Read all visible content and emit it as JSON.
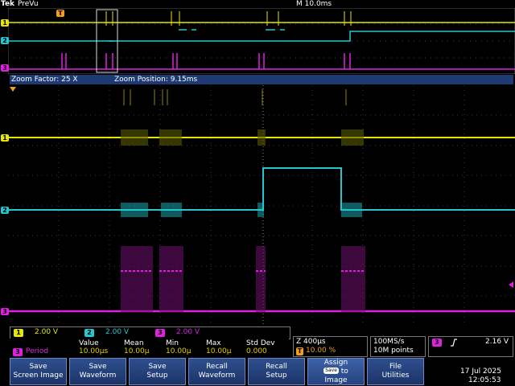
{
  "brand": "Tek",
  "mode": "PreVu",
  "timebase": "M 10.0ms",
  "trigger_marker": "T",
  "channels": [
    {
      "num": "1",
      "color": "#e6e600"
    },
    {
      "num": "2",
      "color": "#22c8d0"
    },
    {
      "num": "3",
      "color": "#e020e0"
    }
  ],
  "zoom": {
    "factor": "Zoom Factor: 25 X",
    "position": "Zoom Position: 9.15ms"
  },
  "scales": [
    {
      "ch": "1",
      "value": "2.00 V"
    },
    {
      "ch": "2",
      "value": "2.00 V"
    },
    {
      "ch": "3",
      "value": "2.00 V"
    }
  ],
  "measurement": {
    "channel": "3",
    "name": "Period",
    "headers": [
      "Value",
      "Mean",
      "Min",
      "Max",
      "Std Dev"
    ],
    "values": [
      "10.00µs",
      "10.00µ",
      "10.00µ",
      "10.00µ",
      "0.000"
    ]
  },
  "horizontal": {
    "zoom_scale": "Z 400µs",
    "trigger_pos": "10.00 %"
  },
  "acquisition": {
    "rate": "100MS/s",
    "points": "10M points"
  },
  "trigger": {
    "channel": "3",
    "slope": "rising-edge-icon",
    "level": "2.16 V"
  },
  "buttons": [
    {
      "l1": "Save",
      "l2": "Screen Image"
    },
    {
      "l1": "Save",
      "l2": "Waveform"
    },
    {
      "l1": "Save",
      "l2": "Setup"
    },
    {
      "l1": "Recall",
      "l2": "Waveform"
    },
    {
      "l1": "Recall",
      "l2": "Setup"
    },
    {
      "l1": "Assign",
      "chip": "Save",
      "to": "to",
      "l2": "Image"
    },
    {
      "l1": "File",
      "l2": "Utilities"
    }
  ],
  "date": "17 Jul  2025",
  "time": "12:05:53"
}
